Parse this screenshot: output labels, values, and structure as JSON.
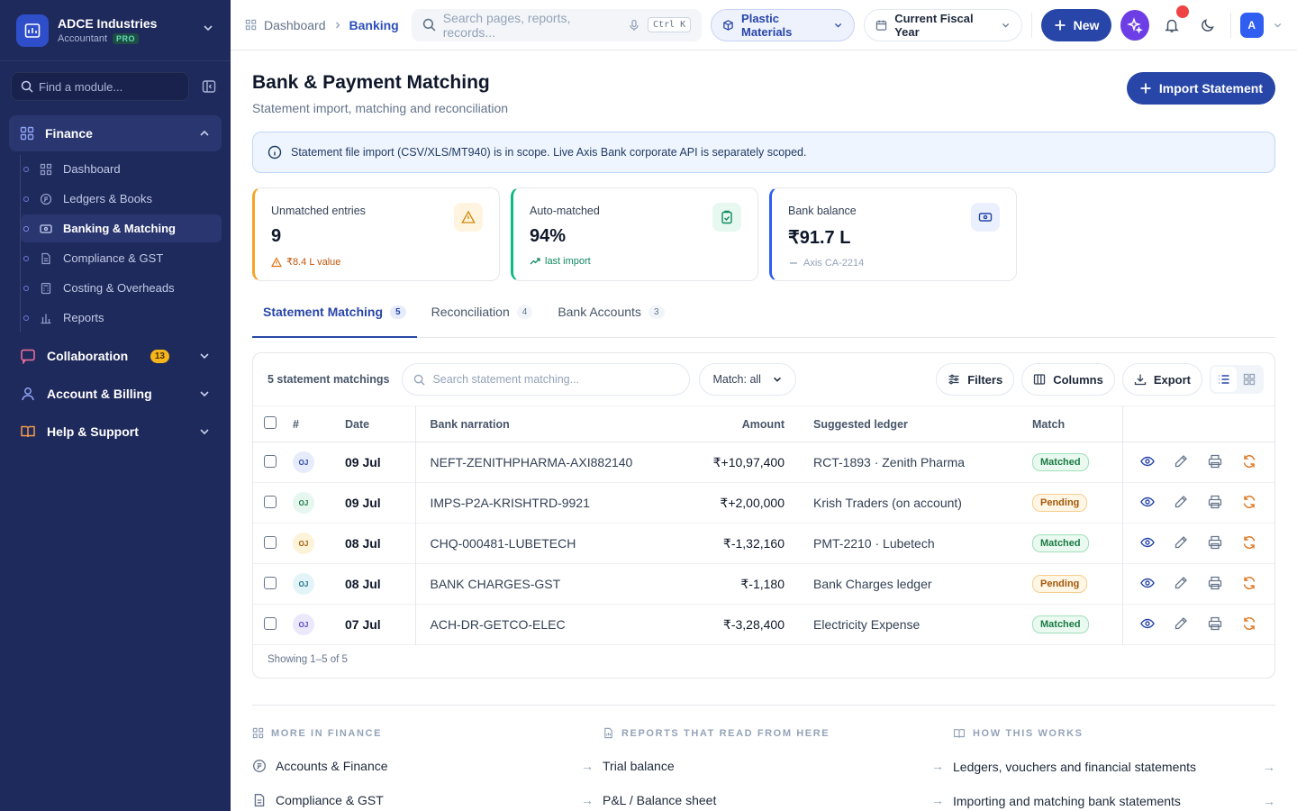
{
  "brand": {
    "name": "ADCE Industries",
    "role": "Accountant",
    "plan": "PRO"
  },
  "sidebar": {
    "search_placeholder": "Find a module...",
    "finance": {
      "label": "Finance",
      "items": [
        {
          "label": "Dashboard",
          "icon": "grid-icon"
        },
        {
          "label": "Ledgers & Books",
          "icon": "coin-icon"
        },
        {
          "label": "Banking & Matching",
          "icon": "bank-card-icon",
          "active": true
        },
        {
          "label": "Compliance & GST",
          "icon": "document-icon"
        },
        {
          "label": "Costing & Overheads",
          "icon": "calculator-icon"
        },
        {
          "label": "Reports",
          "icon": "bar-chart-icon"
        }
      ]
    },
    "groups": [
      {
        "label": "Collaboration",
        "count": "13"
      },
      {
        "label": "Account & Billing",
        "count": ""
      },
      {
        "label": "Help & Support",
        "count": ""
      }
    ]
  },
  "topbar": {
    "breadcrumb": [
      "Dashboard",
      "Banking"
    ],
    "search_placeholder": "Search pages, reports, records...",
    "shortcut": "Ctrl K",
    "company": "Plastic Materials",
    "period": "Current Fiscal Year",
    "new_label": "New",
    "avatar": "A"
  },
  "page": {
    "title": "Bank & Payment Matching",
    "subtitle": "Statement import, matching and reconciliation",
    "import_label": "Import Statement",
    "banner": "Statement file import (CSV/XLS/MT940) is in scope. Live Axis Bank corporate API is separately scoped."
  },
  "kpis": [
    {
      "title": "Unmatched entries",
      "value": "9",
      "foot": "₹8.4 L value",
      "color": "#f5a524",
      "foot_color": "#c2570c",
      "icon_bg": "#fff4e0"
    },
    {
      "title": "Auto-matched",
      "value": "94%",
      "foot": "last import",
      "color": "#10b981",
      "foot_color": "#0f8a5f",
      "icon_bg": "#e7f8f0"
    },
    {
      "title": "Bank balance",
      "value": "₹91.7 L",
      "foot": "Axis CA-2214",
      "color": "#2f5ef0",
      "foot_color": "#94a3b8",
      "icon_bg": "#eaf0fd"
    }
  ],
  "tabs": [
    {
      "label": "Statement Matching",
      "count": "5",
      "active": true
    },
    {
      "label": "Reconciliation",
      "count": "4"
    },
    {
      "label": "Bank Accounts",
      "count": "3"
    }
  ],
  "table": {
    "count_label": "5 statement matchings",
    "search_placeholder": "Search statement matching...",
    "match_filter": "Match: all",
    "filters_label": "Filters",
    "columns_label": "Columns",
    "export_label": "Export",
    "headers": {
      "num": "#",
      "date": "Date",
      "narration": "Bank narration",
      "amount": "Amount",
      "ledger": "Suggested ledger",
      "match": "Match"
    },
    "rows": [
      {
        "tag": "OJ",
        "tag_bg": "#e6ecfb",
        "tag_fg": "#2846a8",
        "date": "09 Jul",
        "narration": "NEFT-ZENITHPHARMA-AXI882140",
        "amount": "₹+10,97,400",
        "ledger": "RCT-1893 · Zenith Pharma",
        "match": "Matched"
      },
      {
        "tag": "OJ",
        "tag_bg": "#e5f7ee",
        "tag_fg": "#1b7a44",
        "date": "09 Jul",
        "narration": "IMPS-P2A-KRISHTRD-9921",
        "amount": "₹+2,00,000",
        "ledger": "Krish Traders (on account)",
        "match": "Pending"
      },
      {
        "tag": "OJ",
        "tag_bg": "#fdf3d8",
        "tag_fg": "#a3590a",
        "date": "08 Jul",
        "narration": "CHQ-000481-LUBETECH",
        "amount": "₹-1,32,160",
        "ledger": "PMT-2210 · Lubetech",
        "match": "Matched"
      },
      {
        "tag": "OJ",
        "tag_bg": "#e3f4f8",
        "tag_fg": "#1f6e87",
        "date": "08 Jul",
        "narration": "BANK CHARGES-GST",
        "amount": "₹-1,180",
        "ledger": "Bank Charges ledger",
        "match": "Pending"
      },
      {
        "tag": "OJ",
        "tag_bg": "#ece8fb",
        "tag_fg": "#5b3fc4",
        "date": "07 Jul",
        "narration": "ACH-DR-GETCO-ELEC",
        "amount": "₹-3,28,400",
        "ledger": "Electricity Expense",
        "match": "Matched"
      }
    ],
    "showing": "Showing 1–5 of 5"
  },
  "footer": {
    "columns": [
      {
        "head": "MORE IN FINANCE",
        "links": [
          "Accounts & Finance",
          "Compliance & GST"
        ]
      },
      {
        "head": "REPORTS THAT READ FROM HERE",
        "links": [
          "Trial balance",
          "P&L / Balance sheet"
        ]
      },
      {
        "head": "HOW THIS WORKS",
        "links": [
          "Ledgers, vouchers and financial statements",
          "Importing and matching bank statements"
        ]
      }
    ]
  }
}
